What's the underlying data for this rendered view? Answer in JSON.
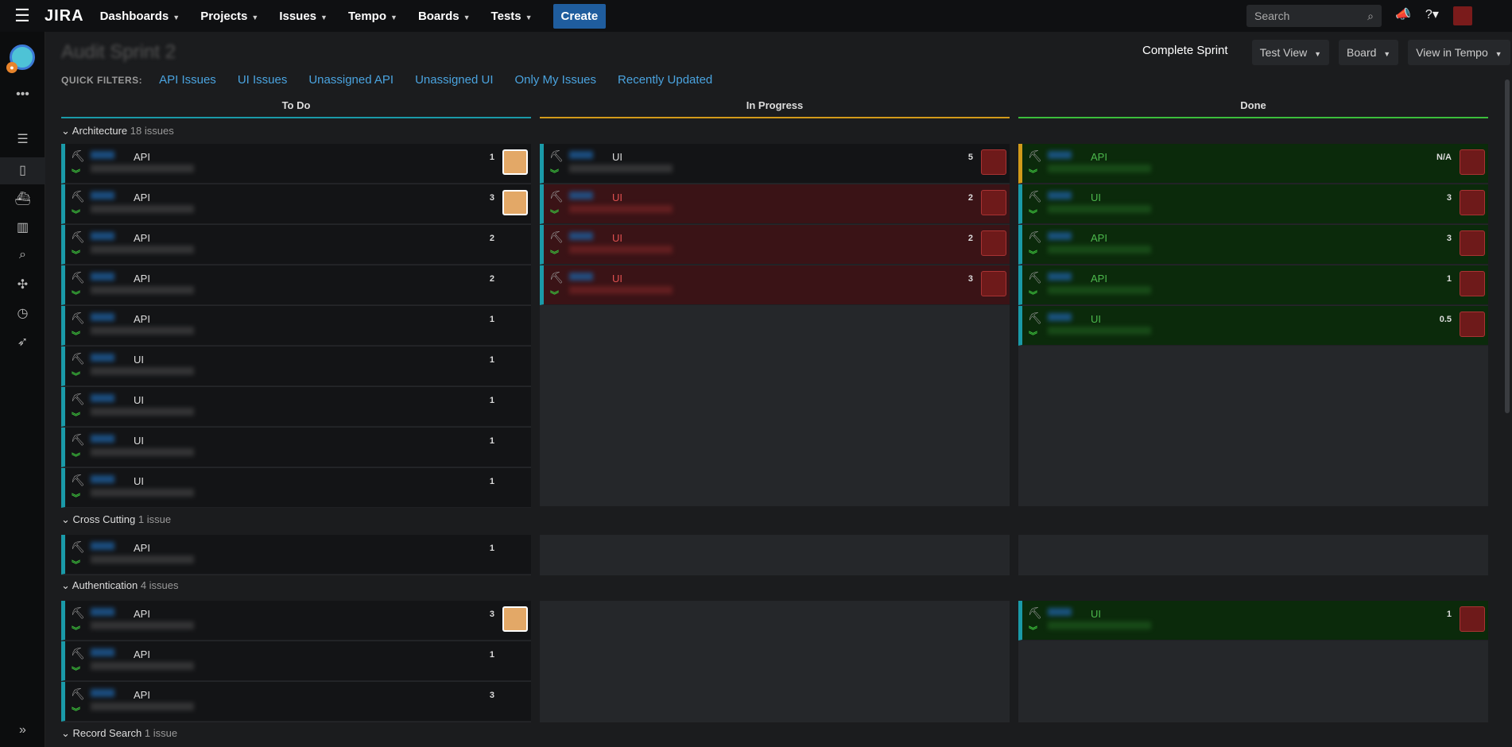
{
  "topbar": {
    "logo": "JIRA",
    "nav": [
      "Dashboards",
      "Projects",
      "Issues",
      "Tempo",
      "Boards",
      "Tests"
    ],
    "create": "Create",
    "search_placeholder": "Search"
  },
  "header": {
    "complete": "Complete Sprint",
    "buttons": [
      "Test View",
      "Board",
      "View in Tempo"
    ]
  },
  "quick_filters": {
    "label": "QUICK FILTERS:",
    "items": [
      "API Issues",
      "UI Issues",
      "Unassigned API",
      "Unassigned UI",
      "Only My Issues",
      "Recently Updated"
    ]
  },
  "columns": [
    "To Do",
    "In Progress",
    "Done"
  ],
  "colors": {
    "todo": "#1a9aa8",
    "inprogress": "#d29a1a",
    "done": "#3bbd3b"
  },
  "swimlanes": [
    {
      "name": "Architecture",
      "count": "18 issues"
    },
    {
      "name": "Cross Cutting",
      "count": "1 issue"
    },
    {
      "name": "Authentication",
      "count": "4 issues"
    },
    {
      "name": "Record Search",
      "count": "1 issue"
    }
  ],
  "cards": {
    "arch_todo": [
      {
        "type": "API",
        "pts": "1"
      },
      {
        "type": "API",
        "pts": "3"
      },
      {
        "type": "API",
        "pts": "2"
      },
      {
        "type": "API",
        "pts": "2"
      },
      {
        "type": "API",
        "pts": "1"
      },
      {
        "type": "UI",
        "pts": "1"
      },
      {
        "type": "UI",
        "pts": "1"
      },
      {
        "type": "UI",
        "pts": "1"
      },
      {
        "type": "UI",
        "pts": "1"
      }
    ],
    "arch_prog": [
      {
        "type": "UI",
        "pts": "5"
      },
      {
        "type": "UI",
        "pts": "2"
      },
      {
        "type": "UI",
        "pts": "2"
      },
      {
        "type": "UI",
        "pts": "3"
      }
    ],
    "arch_done": [
      {
        "type": "API",
        "pts": "N/A"
      },
      {
        "type": "UI",
        "pts": "3"
      },
      {
        "type": "API",
        "pts": "3"
      },
      {
        "type": "API",
        "pts": "1"
      },
      {
        "type": "UI",
        "pts": "0.5"
      }
    ],
    "cross_todo": [
      {
        "type": "API",
        "pts": "1"
      }
    ],
    "auth_todo": [
      {
        "type": "API",
        "pts": "3"
      },
      {
        "type": "API",
        "pts": "1"
      },
      {
        "type": "API",
        "pts": "3"
      }
    ],
    "auth_done": [
      {
        "type": "UI",
        "pts": "1"
      }
    ]
  }
}
